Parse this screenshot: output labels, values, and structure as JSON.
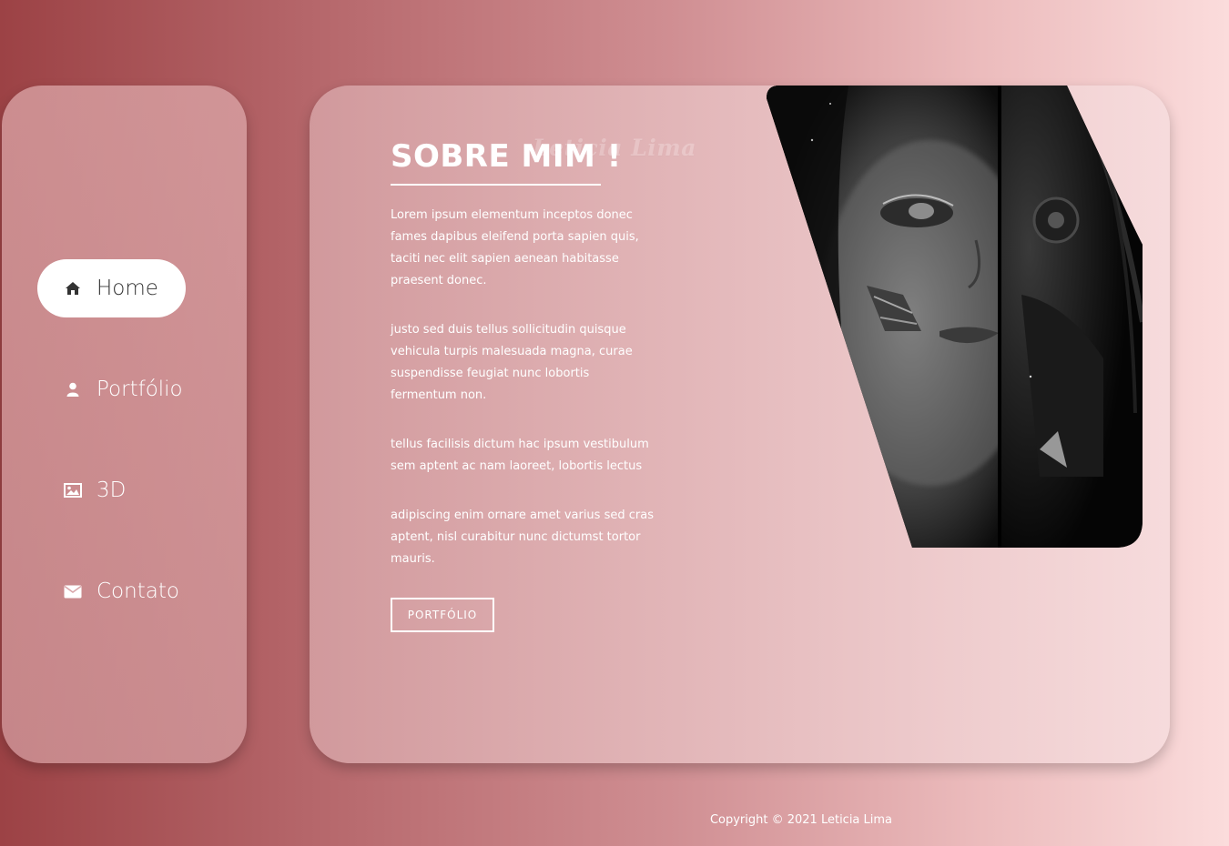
{
  "brand": {
    "name": "Leticia Lima"
  },
  "nav": {
    "items": [
      {
        "label": "Home",
        "icon": "home-icon",
        "active": true
      },
      {
        "label": "Portfólio",
        "icon": "user-icon",
        "active": false
      },
      {
        "label": "3D",
        "icon": "image-icon",
        "active": false
      },
      {
        "label": "Contato",
        "icon": "envelope-icon",
        "active": false
      }
    ]
  },
  "about": {
    "title": "SOBRE MIM !",
    "paragraphs": [
      "Lorem ipsum elementum inceptos donec fames dapibus eleifend porta sapien quis, taciti nec elit sapien aenean habitasse praesent donec.",
      "justo sed duis tellus sollicitudin quisque vehicula turpis malesuada magna, curae suspendisse feugiat nunc lobortis fermentum non.",
      "tellus facilisis dictum hac ipsum vestibulum sem aptent ac nam laoreet, lobortis lectus",
      "adipiscing enim ornare amet varius sed cras aptent, nisl curabitur nunc dictumst tortor mauris."
    ],
    "button_label": "PORTFÓLIO"
  },
  "footer": {
    "copyright": "Copyright © 2021 Leticia Lima"
  },
  "colors": {
    "accent": "#ffffff",
    "background_start": "#9c4245",
    "background_end": "#fbdcdc"
  }
}
